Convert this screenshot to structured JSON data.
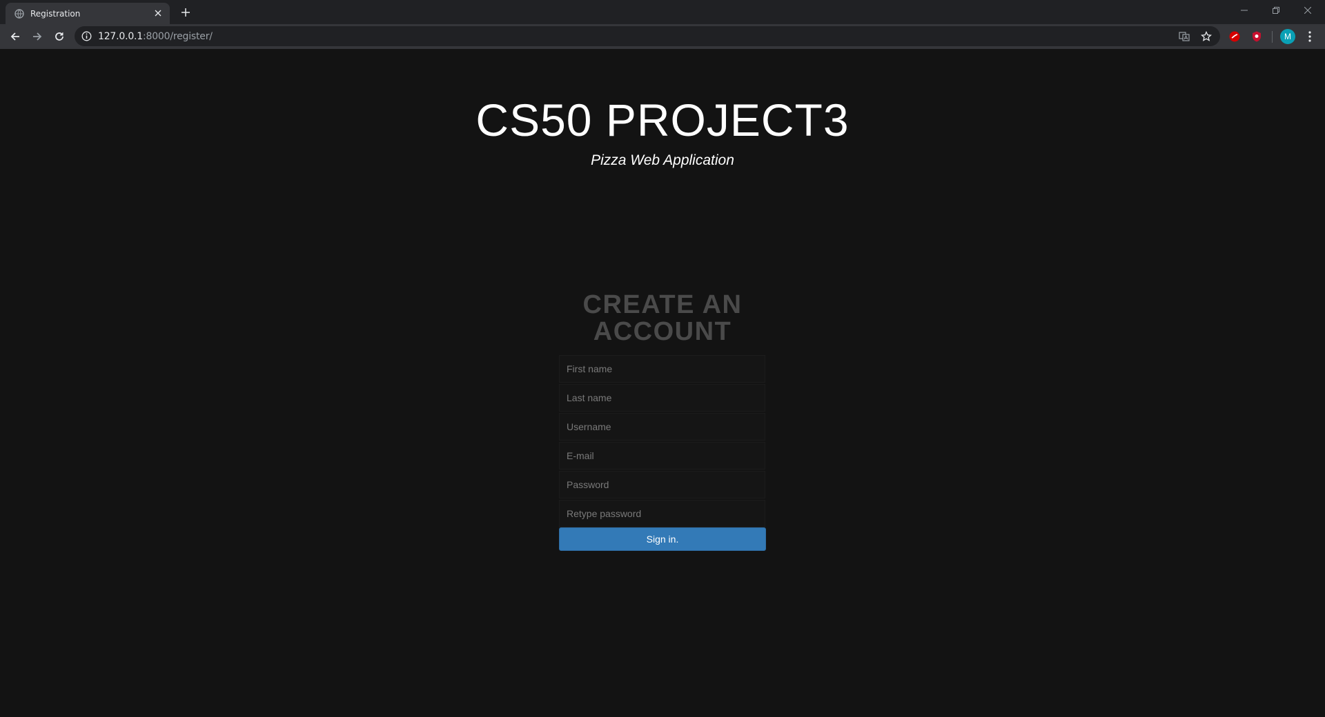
{
  "browser": {
    "tab_title": "Registration",
    "url_host": "127.0.0.1",
    "url_rest": ":8000/register/",
    "avatar_letter": "M"
  },
  "page": {
    "title": "CS50 PROJECT3",
    "subtitle": "Pizza Web Application"
  },
  "form": {
    "heading": "CREATE AN ACCOUNT",
    "fields": [
      {
        "placeholder": "First name"
      },
      {
        "placeholder": "Last name"
      },
      {
        "placeholder": "Username"
      },
      {
        "placeholder": "E-mail"
      },
      {
        "placeholder": "Password"
      },
      {
        "placeholder": "Retype password"
      }
    ],
    "submit_label": "Sign in."
  },
  "colors": {
    "background": "#131313",
    "button": "#337ab7",
    "heading": "#4a4a4a"
  }
}
